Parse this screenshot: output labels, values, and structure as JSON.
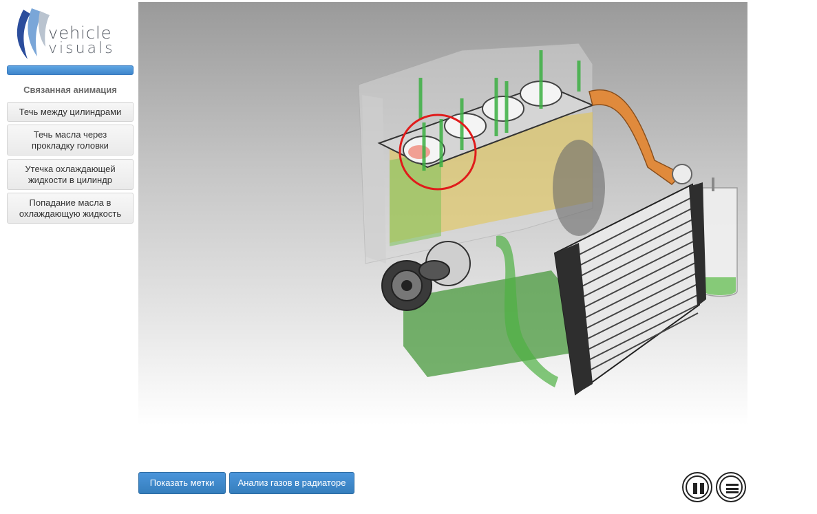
{
  "logo": {
    "line1": "vehicle",
    "line2": "visuals"
  },
  "sidebar": {
    "title": "Связанная анимация",
    "items": [
      {
        "label": "Течь между цилиндрами"
      },
      {
        "label": "Течь масла через прокладку головки"
      },
      {
        "label": "Утечка охлаждающей жидкости в цилиндр"
      },
      {
        "label": "Попадание масла в охлаждающую жидкость"
      }
    ]
  },
  "controls": {
    "show_labels": "Показать метки",
    "gas_analysis": "Анализ газов в радиаторе",
    "pause_icon": "pause-icon",
    "menu_icon": "menu-icon"
  },
  "colors": {
    "accent_blue": "#428bca",
    "coolant_green": "#3cb043",
    "hose_orange": "#e08a3c",
    "highlight_red": "#e01b1b"
  }
}
